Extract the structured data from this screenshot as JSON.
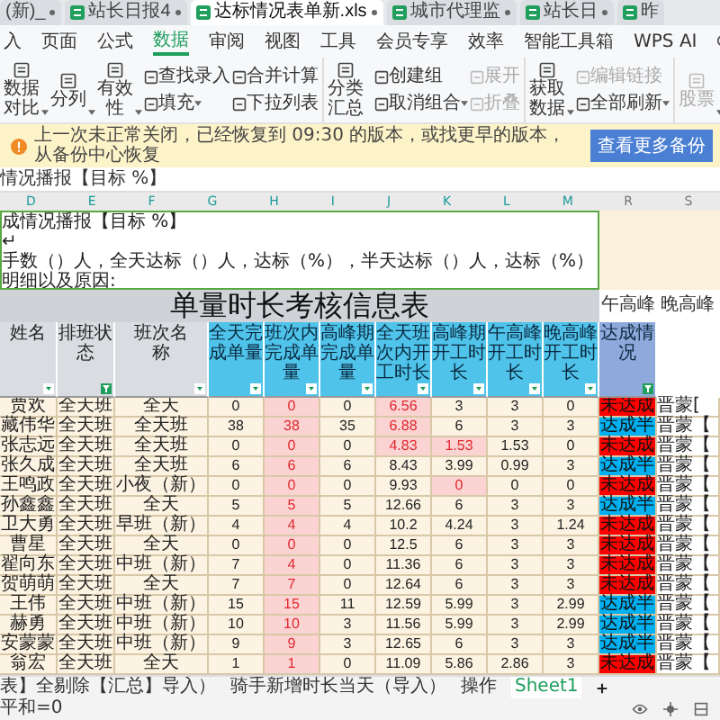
{
  "file_tabs": [
    {
      "label": "(新)_",
      "selected": false
    },
    {
      "label": "站长日报4",
      "selected": false
    },
    {
      "label": "达标情况表单新.xls",
      "selected": true
    },
    {
      "label": "城市代理监",
      "selected": false
    },
    {
      "label": "站长日",
      "selected": false
    },
    {
      "label": "昨",
      "selected": false
    }
  ],
  "menu": [
    {
      "label": "入",
      "selected": false
    },
    {
      "label": "页面",
      "selected": false
    },
    {
      "label": "公式",
      "selected": false
    },
    {
      "label": "数据",
      "selected": true
    },
    {
      "label": "审阅",
      "selected": false
    },
    {
      "label": "视图",
      "selected": false
    },
    {
      "label": "工具",
      "selected": false
    },
    {
      "label": "会员专享",
      "selected": false
    },
    {
      "label": "效率",
      "selected": false
    },
    {
      "label": "智能工具箱",
      "selected": false
    },
    {
      "label": "WPS AI",
      "selected": false
    }
  ],
  "ribbon": [
    {
      "columns": [
        [
          {
            "label": "数据对比",
            "dropdown": true,
            "disabled": false
          }
        ],
        [
          {
            "label": "分列",
            "dropdown": true,
            "disabled": false
          }
        ],
        [
          {
            "label": "有效性",
            "dropdown": true,
            "disabled": false
          }
        ],
        [
          {
            "label": "查找录入",
            "dropdown": false,
            "disabled": false
          },
          {
            "label": "填充",
            "dropdown": true,
            "disabled": false
          }
        ],
        [
          {
            "label": "合并计算",
            "dropdown": false,
            "disabled": false
          },
          {
            "label": "下拉列表",
            "dropdown": false,
            "disabled": false
          }
        ]
      ]
    },
    {
      "columns": [
        [
          {
            "label": "分类汇总",
            "dropdown": false,
            "disabled": false
          }
        ],
        [
          {
            "label": "创建组",
            "dropdown": false,
            "disabled": false
          },
          {
            "label": "取消组合",
            "dropdown": true,
            "disabled": false
          }
        ],
        [
          {
            "label": "展开",
            "dropdown": false,
            "disabled": true
          },
          {
            "label": "折叠",
            "dropdown": false,
            "disabled": true
          }
        ]
      ]
    },
    {
      "columns": [
        [
          {
            "label": "获取数据",
            "dropdown": true,
            "disabled": false
          }
        ],
        [
          {
            "label": "编辑链接",
            "dropdown": false,
            "disabled": true
          },
          {
            "label": "全部刷新",
            "dropdown": true,
            "disabled": false
          }
        ]
      ]
    },
    {
      "columns": [
        [
          {
            "label": "股票",
            "dropdown": true,
            "disabled": true
          }
        ]
      ]
    }
  ],
  "notification": {
    "message": "上一次未正常关闭，已经恢复到 09:30 的版本，或找更早的版本，从备份中心恢复",
    "button": "查看更多备份"
  },
  "formula_bar": {
    "text": "情况播报【目标 %】"
  },
  "columns": [
    "D",
    "E",
    "F",
    "G",
    "H",
    "I",
    "J",
    "K",
    "L",
    "M"
  ],
  "right_columns": [
    "R",
    "S"
  ],
  "merged_cell": {
    "lines": [
      "成情况播报【目标 %】",
      "↵",
      "手数（）人，全天达标（）人，达标（%），半天达标（）人，达标（%）",
      "明细以及原因:"
    ]
  },
  "sheet": {
    "title": "单量时长考核信息表",
    "right_labels": [
      "午高峰",
      "晚高峰"
    ],
    "headers": [
      {
        "label": "姓名",
        "filtered": false
      },
      {
        "label": "排班状态",
        "filtered": true
      },
      {
        "label": "班次名称",
        "filtered": false
      },
      {
        "label": "全天完成单量",
        "filtered": false
      },
      {
        "label": "班次内完成单量",
        "filtered": false
      },
      {
        "label": "高峰期完成单量",
        "filtered": false
      },
      {
        "label": "全天班次内开工时长",
        "filtered": false
      },
      {
        "label": "高峰期开工时长",
        "filtered": false
      },
      {
        "label": "午高峰开工时长",
        "filtered": false
      },
      {
        "label": "晚高峰开工时长",
        "filtered": false
      },
      {
        "label": "达成情况",
        "filtered": true
      }
    ],
    "rows": [
      {
        "cells": [
          "贾欢",
          "全天班",
          "全天",
          "0",
          "0",
          "0",
          "6.56",
          "3",
          "3",
          "0"
        ],
        "flagged": [
          false,
          false,
          false,
          false,
          true,
          false,
          true,
          false,
          false,
          false
        ],
        "status": {
          "label": "未达成",
          "color": "#ff0000"
        },
        "note": "晋蒙["
      },
      {
        "cells": [
          "藏伟华",
          "全天班",
          "全天班",
          "38",
          "38",
          "35",
          "6.88",
          "6",
          "3",
          "3"
        ],
        "flagged": [
          false,
          false,
          false,
          false,
          true,
          false,
          true,
          false,
          false,
          false
        ],
        "status": {
          "label": "达成半",
          "color": "#00b0f0"
        },
        "note": "晋蒙【"
      },
      {
        "cells": [
          "张志远",
          "全天班",
          "全天班",
          "0",
          "0",
          "0",
          "4.83",
          "1.53",
          "1.53",
          "0"
        ],
        "flagged": [
          false,
          false,
          false,
          false,
          true,
          false,
          true,
          true,
          false,
          false
        ],
        "status": {
          "label": "未达成",
          "color": "#ff0000"
        },
        "note": "晋蒙【"
      },
      {
        "cells": [
          "张久成",
          "全天班",
          "全天班",
          "6",
          "6",
          "6",
          "8.43",
          "3.99",
          "0.99",
          "3"
        ],
        "flagged": [
          false,
          false,
          false,
          false,
          true,
          false,
          false,
          false,
          false,
          false
        ],
        "status": {
          "label": "达成半",
          "color": "#00b0f0"
        },
        "note": "晋蒙【"
      },
      {
        "cells": [
          "王鸣政",
          "全天班",
          "小夜（新）",
          "0",
          "0",
          "0",
          "9.93",
          "0",
          "0",
          "0"
        ],
        "flagged": [
          false,
          false,
          false,
          false,
          true,
          false,
          false,
          true,
          false,
          false
        ],
        "status": {
          "label": "未达成",
          "color": "#ff0000"
        },
        "note": "晋蒙【"
      },
      {
        "cells": [
          "孙鑫鑫",
          "全天班",
          "全天",
          "5",
          "5",
          "5",
          "12.66",
          "6",
          "3",
          "3"
        ],
        "flagged": [
          false,
          false,
          false,
          false,
          true,
          false,
          false,
          false,
          false,
          false
        ],
        "status": {
          "label": "达成半",
          "color": "#00b0f0"
        },
        "note": "晋蒙【"
      },
      {
        "cells": [
          "卫大勇",
          "全天班",
          "早班（新）",
          "4",
          "4",
          "4",
          "10.2",
          "4.24",
          "3",
          "1.24"
        ],
        "flagged": [
          false,
          false,
          false,
          false,
          true,
          false,
          false,
          false,
          false,
          false
        ],
        "status": {
          "label": "未达成",
          "color": "#ff0000"
        },
        "note": "晋蒙【"
      },
      {
        "cells": [
          "曹星",
          "全天班",
          "全天",
          "0",
          "0",
          "0",
          "12.5",
          "6",
          "3",
          "3"
        ],
        "flagged": [
          false,
          false,
          false,
          false,
          true,
          false,
          false,
          false,
          false,
          false
        ],
        "status": {
          "label": "未达成",
          "color": "#ff0000"
        },
        "note": "晋蒙【"
      },
      {
        "cells": [
          "翟向东",
          "全天班",
          "中班（新）",
          "7",
          "4",
          "0",
          "11.36",
          "6",
          "3",
          "3"
        ],
        "flagged": [
          false,
          false,
          false,
          false,
          true,
          false,
          false,
          false,
          false,
          false
        ],
        "status": {
          "label": "未达成",
          "color": "#ff0000"
        },
        "note": "晋蒙【"
      },
      {
        "cells": [
          "贺萌萌",
          "全天班",
          "全天",
          "7",
          "7",
          "0",
          "12.64",
          "6",
          "3",
          "3"
        ],
        "flagged": [
          false,
          false,
          false,
          false,
          true,
          false,
          false,
          false,
          false,
          false
        ],
        "status": {
          "label": "未达成",
          "color": "#ff0000"
        },
        "note": "晋蒙【"
      },
      {
        "cells": [
          "王伟",
          "全天班",
          "中班（新）",
          "15",
          "15",
          "11",
          "12.59",
          "5.99",
          "3",
          "2.99"
        ],
        "flagged": [
          false,
          false,
          false,
          false,
          true,
          false,
          false,
          false,
          false,
          false
        ],
        "status": {
          "label": "达成半",
          "color": "#00b0f0"
        },
        "note": "晋蒙【"
      },
      {
        "cells": [
          "赫勇",
          "全天班",
          "中班（新）",
          "10",
          "10",
          "3",
          "11.56",
          "5.99",
          "3",
          "2.99"
        ],
        "flagged": [
          false,
          false,
          false,
          false,
          true,
          false,
          false,
          false,
          false,
          false
        ],
        "status": {
          "label": "达成半",
          "color": "#00b0f0"
        },
        "note": "晋蒙【"
      },
      {
        "cells": [
          "安蒙蒙",
          "全天班",
          "中班（新）",
          "9",
          "9",
          "3",
          "12.65",
          "6",
          "3",
          "3"
        ],
        "flagged": [
          false,
          false,
          false,
          false,
          true,
          false,
          false,
          false,
          false,
          false
        ],
        "status": {
          "label": "达成半",
          "color": "#00b0f0"
        },
        "note": "晋蒙【"
      },
      {
        "cells": [
          "翁宏",
          "全天班",
          "全天",
          "1",
          "1",
          "0",
          "11.09",
          "5.86",
          "2.86",
          "3"
        ],
        "flagged": [
          false,
          false,
          false,
          false,
          true,
          false,
          false,
          false,
          false,
          false
        ],
        "status": {
          "label": "未达成",
          "color": "#ff0000"
        },
        "note": "晋蒙【"
      }
    ]
  },
  "sheet_tabs": [
    {
      "label": "表】全剔除【汇总】导入）",
      "selected": false
    },
    {
      "label": "骑手新增时长当天（导入）",
      "selected": false
    },
    {
      "label": "操作",
      "selected": false
    },
    {
      "label": "Sheet1",
      "selected": true
    }
  ],
  "status_bar": {
    "text": "平和=0"
  }
}
